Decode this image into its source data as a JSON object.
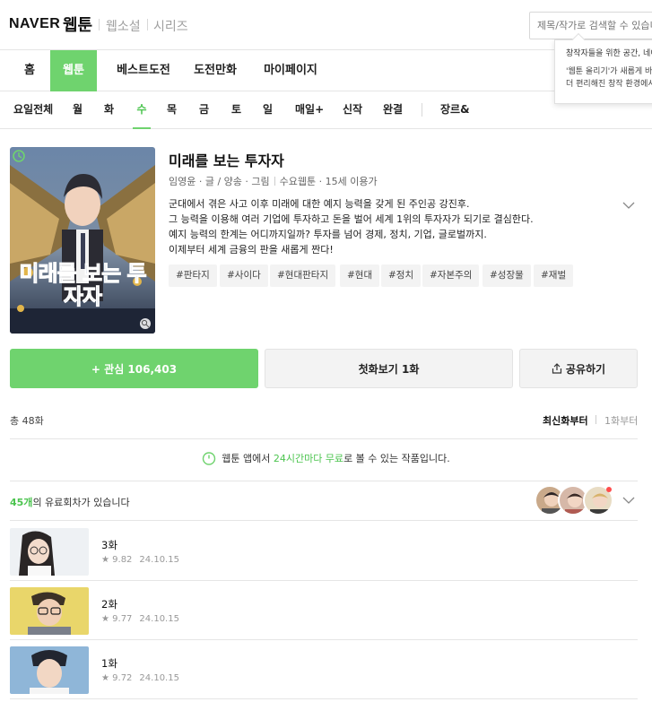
{
  "header": {
    "logo_naver": "NAVER",
    "logo_webtoon": "웹툰",
    "service_links": [
      "웹소설",
      "시리즈"
    ],
    "search_placeholder": "제목/작가로 검색할 수 있습니다."
  },
  "tooltip": {
    "line1": "창작자들을 위한 공간, 네이버 웹툰 창작자센터",
    "line2": "'웹툰 올리기'가 새롭게 바뀌었습니다.",
    "line3": "더 편리해진 창작 환경에서"
  },
  "main_nav": [
    "홈",
    "웹툰",
    "베스트도전",
    "도전만화",
    "마이페이지"
  ],
  "day_nav": [
    "요일전체",
    "월",
    "화",
    "수",
    "목",
    "금",
    "토",
    "일",
    "매일+",
    "신작",
    "완결",
    "장르&"
  ],
  "work": {
    "title": "미래를 보는 투자자",
    "meta": [
      "임영윤 · 글 / 양송 · 그림",
      "수요웹툰 · 15세 이용가"
    ],
    "description": [
      "군대에서 겪은 사고 이후 미래에 대한 예지 능력을 갖게 된 주인공 강진후.",
      "그 능력을 이용해 여러 기업에 투자하고 돈을 벌어 세계 1위의 투자자가 되기로 결심한다.",
      "예지 능력의 한계는 어디까지일까? 투자를 넘어 경제, 정치, 기업, 글로벌까지.",
      "이제부터 세계 금융의 판을 새롭게 짠다!"
    ],
    "tags": [
      "#판타지",
      "#사이다",
      "#현대판타지",
      "#현대",
      "#정치",
      "#자본주의",
      "#성장물",
      "#재벌"
    ],
    "cover_text": "미래를 보는 투자자"
  },
  "actions": {
    "like_label": "+ 관심 106,403",
    "first_label": "첫화보기 1화",
    "share_label": "공유하기"
  },
  "list": {
    "total": "총 48화",
    "sort_new": "최신화부터",
    "sort_first": "1화부터",
    "notice_pre": "웹툰 앱에서 ",
    "notice_green": "24시간마다 무료",
    "notice_post": "로 볼 수 있는 작품입니다.",
    "paid_count": "45개",
    "paid_text": "의 유료회차가 있습니다",
    "episodes": [
      {
        "title": "3화",
        "rating": "9.82",
        "date": "24.10.15"
      },
      {
        "title": "2화",
        "rating": "9.77",
        "date": "24.10.15"
      },
      {
        "title": "1화",
        "rating": "9.72",
        "date": "24.10.15"
      }
    ]
  },
  "colors": {
    "accent": "#6fd36e",
    "accent_text": "#4cc44f"
  }
}
